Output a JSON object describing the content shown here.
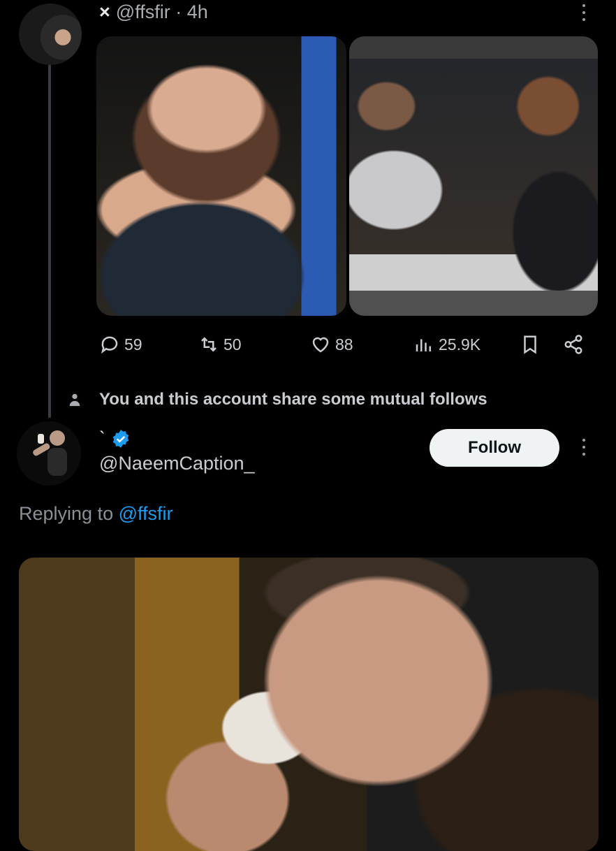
{
  "tweet": {
    "close_glyph": "×",
    "handle": "@ffsfir",
    "separator": "·",
    "time": "4h",
    "avatar_icon": "avatar-photo",
    "more_icon": "more-vertical-icon",
    "media_left_icon": "photo-woman-event",
    "media_right_icon": "photo-podcast-studio",
    "stats": {
      "replies": "59",
      "reposts": "50",
      "likes": "88",
      "views": "25.9K"
    }
  },
  "mutual": {
    "icon": "person-icon",
    "text": "You and this account share some mutual follows"
  },
  "reply": {
    "display_name": "`",
    "verified_icon": "verified-badge-icon",
    "handle": "@NaeemCaption_",
    "follow_label": "Follow",
    "replying_prefix": "Replying to",
    "replying_mention": "@ffsfir",
    "media_icon": "photo-man-drinking-milk"
  },
  "colors": {
    "background": "#000000",
    "text_primary": "#e7e9ea",
    "text_secondary": "#8b9096",
    "link_blue": "#1d9bf0",
    "verified_blue": "#1d9bf0",
    "follow_button_bg": "#eff3f4"
  }
}
